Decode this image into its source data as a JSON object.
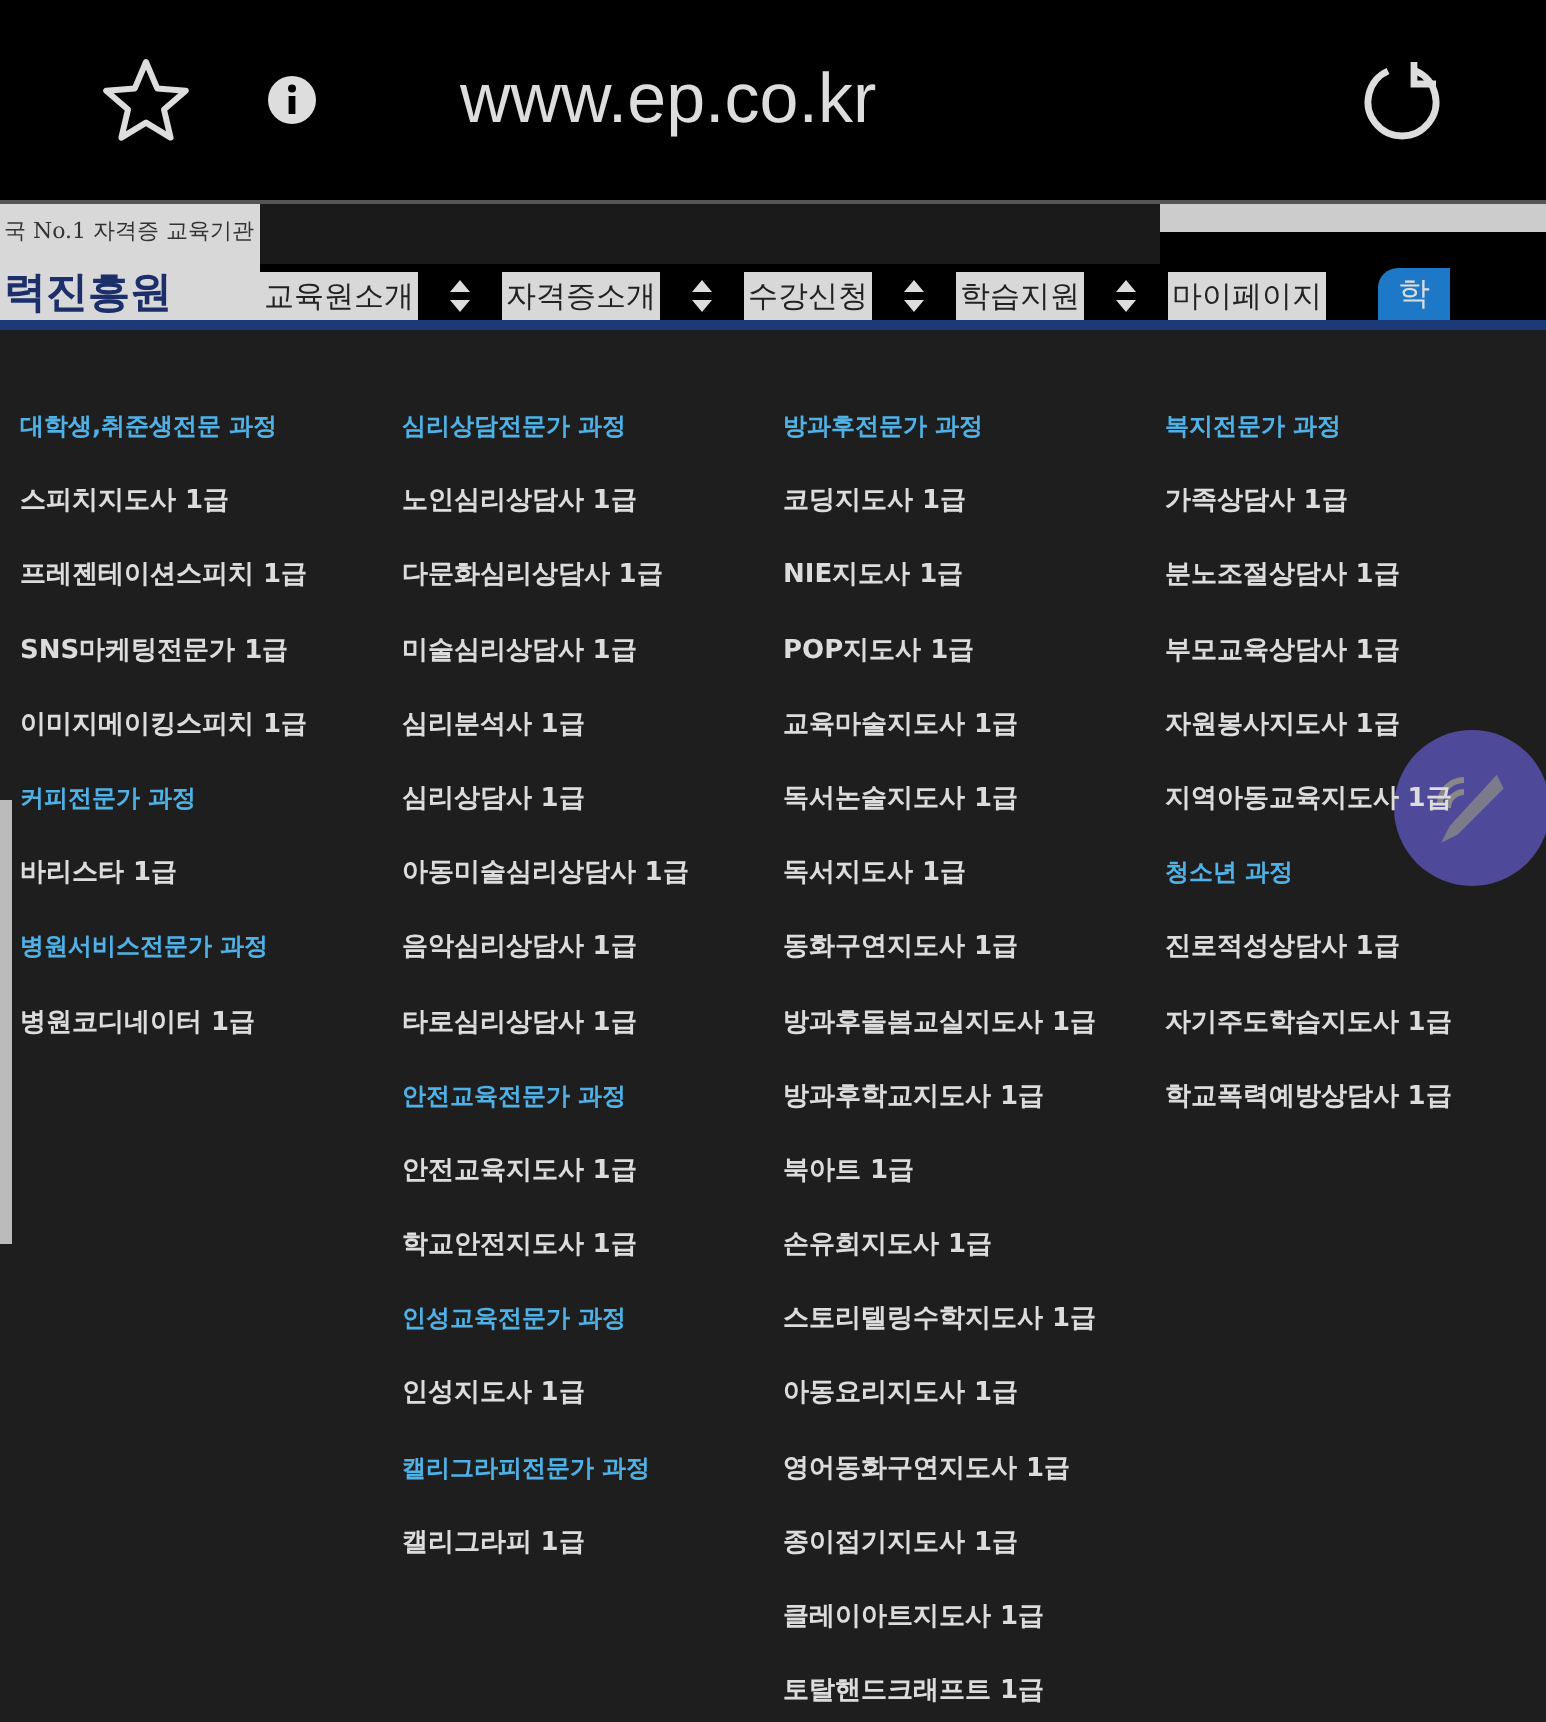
{
  "browser": {
    "url": "www.ep.co.kr"
  },
  "header": {
    "tagline": "국 No.1 자격증 교육기관",
    "logo": "력진흥원",
    "nav": [
      {
        "label": "교육원소개",
        "kind": "menu"
      },
      {
        "label": "자격증소개",
        "kind": "menu"
      },
      {
        "label": "수강신청",
        "kind": "menu"
      },
      {
        "label": "학습지원",
        "kind": "menu"
      },
      {
        "label": "마이페이지",
        "kind": "menu"
      },
      {
        "label": "학",
        "kind": "pill"
      }
    ]
  },
  "columns": [
    [
      {
        "kind": "heading",
        "text": "대학생,취준생전문 과정"
      },
      {
        "kind": "item",
        "text": "스피치지도사 1급"
      },
      {
        "kind": "item",
        "text": "프레젠테이션스피치 1급"
      },
      {
        "kind": "item",
        "text": "SNS마케팅전문가 1급"
      },
      {
        "kind": "item",
        "text": "이미지메이킹스피치 1급"
      },
      {
        "kind": "heading",
        "text": "커피전문가 과정"
      },
      {
        "kind": "item",
        "text": "바리스타 1급"
      },
      {
        "kind": "heading",
        "text": "병원서비스전문가 과정"
      },
      {
        "kind": "item",
        "text": "병원코디네이터 1급"
      }
    ],
    [
      {
        "kind": "heading",
        "text": "심리상담전문가 과정"
      },
      {
        "kind": "item",
        "text": "노인심리상담사 1급"
      },
      {
        "kind": "item",
        "text": "다문화심리상담사 1급"
      },
      {
        "kind": "item",
        "text": "미술심리상담사 1급"
      },
      {
        "kind": "item",
        "text": "심리분석사 1급"
      },
      {
        "kind": "item",
        "text": "심리상담사 1급"
      },
      {
        "kind": "item",
        "text": "아동미술심리상담사 1급"
      },
      {
        "kind": "item",
        "text": "음악심리상담사 1급"
      },
      {
        "kind": "item",
        "text": "타로심리상담사 1급"
      },
      {
        "kind": "heading",
        "text": "안전교육전문가 과정"
      },
      {
        "kind": "item",
        "text": "안전교육지도사 1급"
      },
      {
        "kind": "item",
        "text": "학교안전지도사 1급"
      },
      {
        "kind": "heading",
        "text": "인성교육전문가 과정"
      },
      {
        "kind": "item",
        "text": "인성지도사 1급"
      },
      {
        "kind": "heading",
        "text": "캘리그라피전문가 과정"
      },
      {
        "kind": "item",
        "text": "캘리그라피 1급"
      }
    ],
    [
      {
        "kind": "heading",
        "text": "방과후전문가 과정"
      },
      {
        "kind": "item",
        "text": "코딩지도사 1급"
      },
      {
        "kind": "item",
        "text": "NIE지도사 1급"
      },
      {
        "kind": "item",
        "text": "POP지도사 1급"
      },
      {
        "kind": "item",
        "text": "교육마술지도사 1급"
      },
      {
        "kind": "item",
        "text": "독서논술지도사 1급"
      },
      {
        "kind": "item",
        "text": "독서지도사 1급"
      },
      {
        "kind": "item",
        "text": "동화구연지도사 1급"
      },
      {
        "kind": "item",
        "text": "방과후돌봄교실지도사 1급"
      },
      {
        "kind": "item",
        "text": "방과후학교지도사 1급"
      },
      {
        "kind": "item",
        "text": "북아트 1급"
      },
      {
        "kind": "item",
        "text": "손유희지도사 1급"
      },
      {
        "kind": "item",
        "text": "스토리텔링수학지도사 1급"
      },
      {
        "kind": "item",
        "text": "아동요리지도사 1급"
      },
      {
        "kind": "item",
        "text": "영어동화구연지도사 1급"
      },
      {
        "kind": "item",
        "text": "종이접기지도사 1급"
      },
      {
        "kind": "item",
        "text": "클레이아트지도사 1급"
      },
      {
        "kind": "item",
        "text": "토탈핸드크래프트 1급"
      }
    ],
    [
      {
        "kind": "heading",
        "text": "복지전문가 과정"
      },
      {
        "kind": "item",
        "text": "가족상담사 1급"
      },
      {
        "kind": "item",
        "text": "분노조절상담사 1급"
      },
      {
        "kind": "item",
        "text": "부모교육상담사 1급"
      },
      {
        "kind": "item",
        "text": "자원봉사지도사 1급"
      },
      {
        "kind": "item",
        "text": "지역아동교육지도사 1급"
      },
      {
        "kind": "heading",
        "text": "청소년 과정"
      },
      {
        "kind": "item",
        "text": "진로적성상담사 1급"
      },
      {
        "kind": "item",
        "text": "자기주도학습지도사 1급"
      },
      {
        "kind": "item",
        "text": "학교폭력예방상담사 1급"
      }
    ]
  ]
}
